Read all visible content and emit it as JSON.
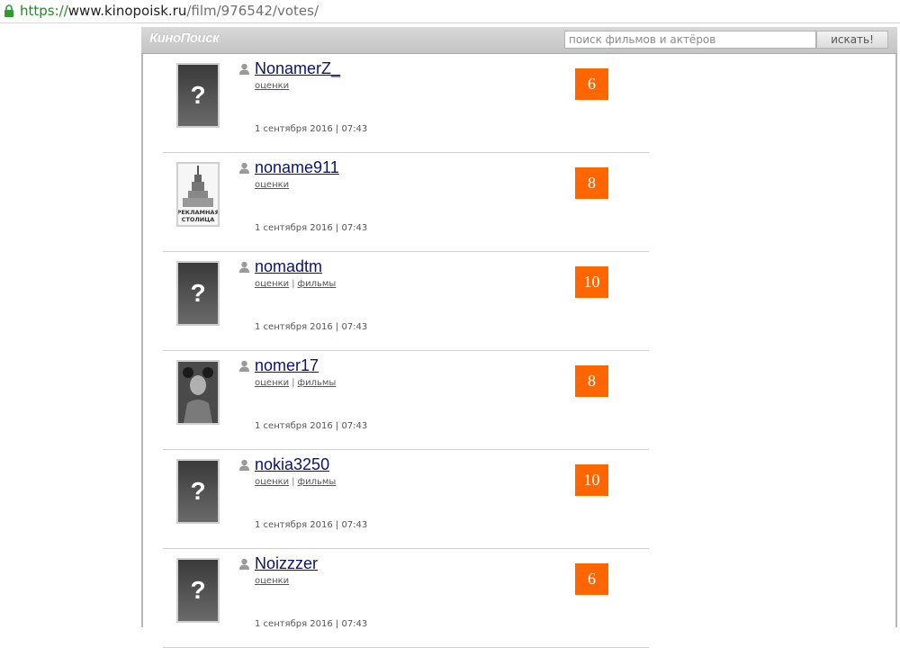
{
  "browser": {
    "url_scheme": "https://",
    "url_host": "www.kinopoisk.ru",
    "url_path": "/film/976542/votes/"
  },
  "header": {
    "logo": "КиноПоиск",
    "search_placeholder": "поиск фильмов и актёров",
    "search_button": "искать!"
  },
  "votes": [
    {
      "username": "NonamerZ_",
      "link1": "оценки",
      "link2": "",
      "date": "1 сентября 2016 | 07:43",
      "rating": "6",
      "avatar": "unknown"
    },
    {
      "username": "noname911",
      "link1": "оценки",
      "link2": "",
      "date": "1 сентября 2016 | 07:43",
      "rating": "8",
      "avatar": "building",
      "avatar_text_1": "РЕКЛАМНАЯ",
      "avatar_text_2": "СТОЛИЦА"
    },
    {
      "username": "nomadtm",
      "link1": "оценки",
      "link2": "фильмы",
      "date": "1 сентября 2016 | 07:43",
      "rating": "10",
      "avatar": "unknown"
    },
    {
      "username": "nomer17",
      "link1": "оценки",
      "link2": "фильмы",
      "date": "1 сентября 2016 | 07:43",
      "rating": "8",
      "avatar": "photo"
    },
    {
      "username": "nokia3250",
      "link1": "оценки",
      "link2": "фильмы",
      "date": "1 сентября 2016 | 07:43",
      "rating": "10",
      "avatar": "unknown"
    },
    {
      "username": "Noizzzer",
      "link1": "оценки",
      "link2": "",
      "date": "1 сентября 2016 | 07:43",
      "rating": "6",
      "avatar": "unknown"
    }
  ],
  "colors": {
    "rating_bg": "#ff6600",
    "username_link": "#0b1370",
    "url_secure": "#1a8f1a"
  },
  "icons": {
    "lock": "lock-icon",
    "user": "user-icon",
    "unknown_avatar": "question-mark-icon"
  }
}
